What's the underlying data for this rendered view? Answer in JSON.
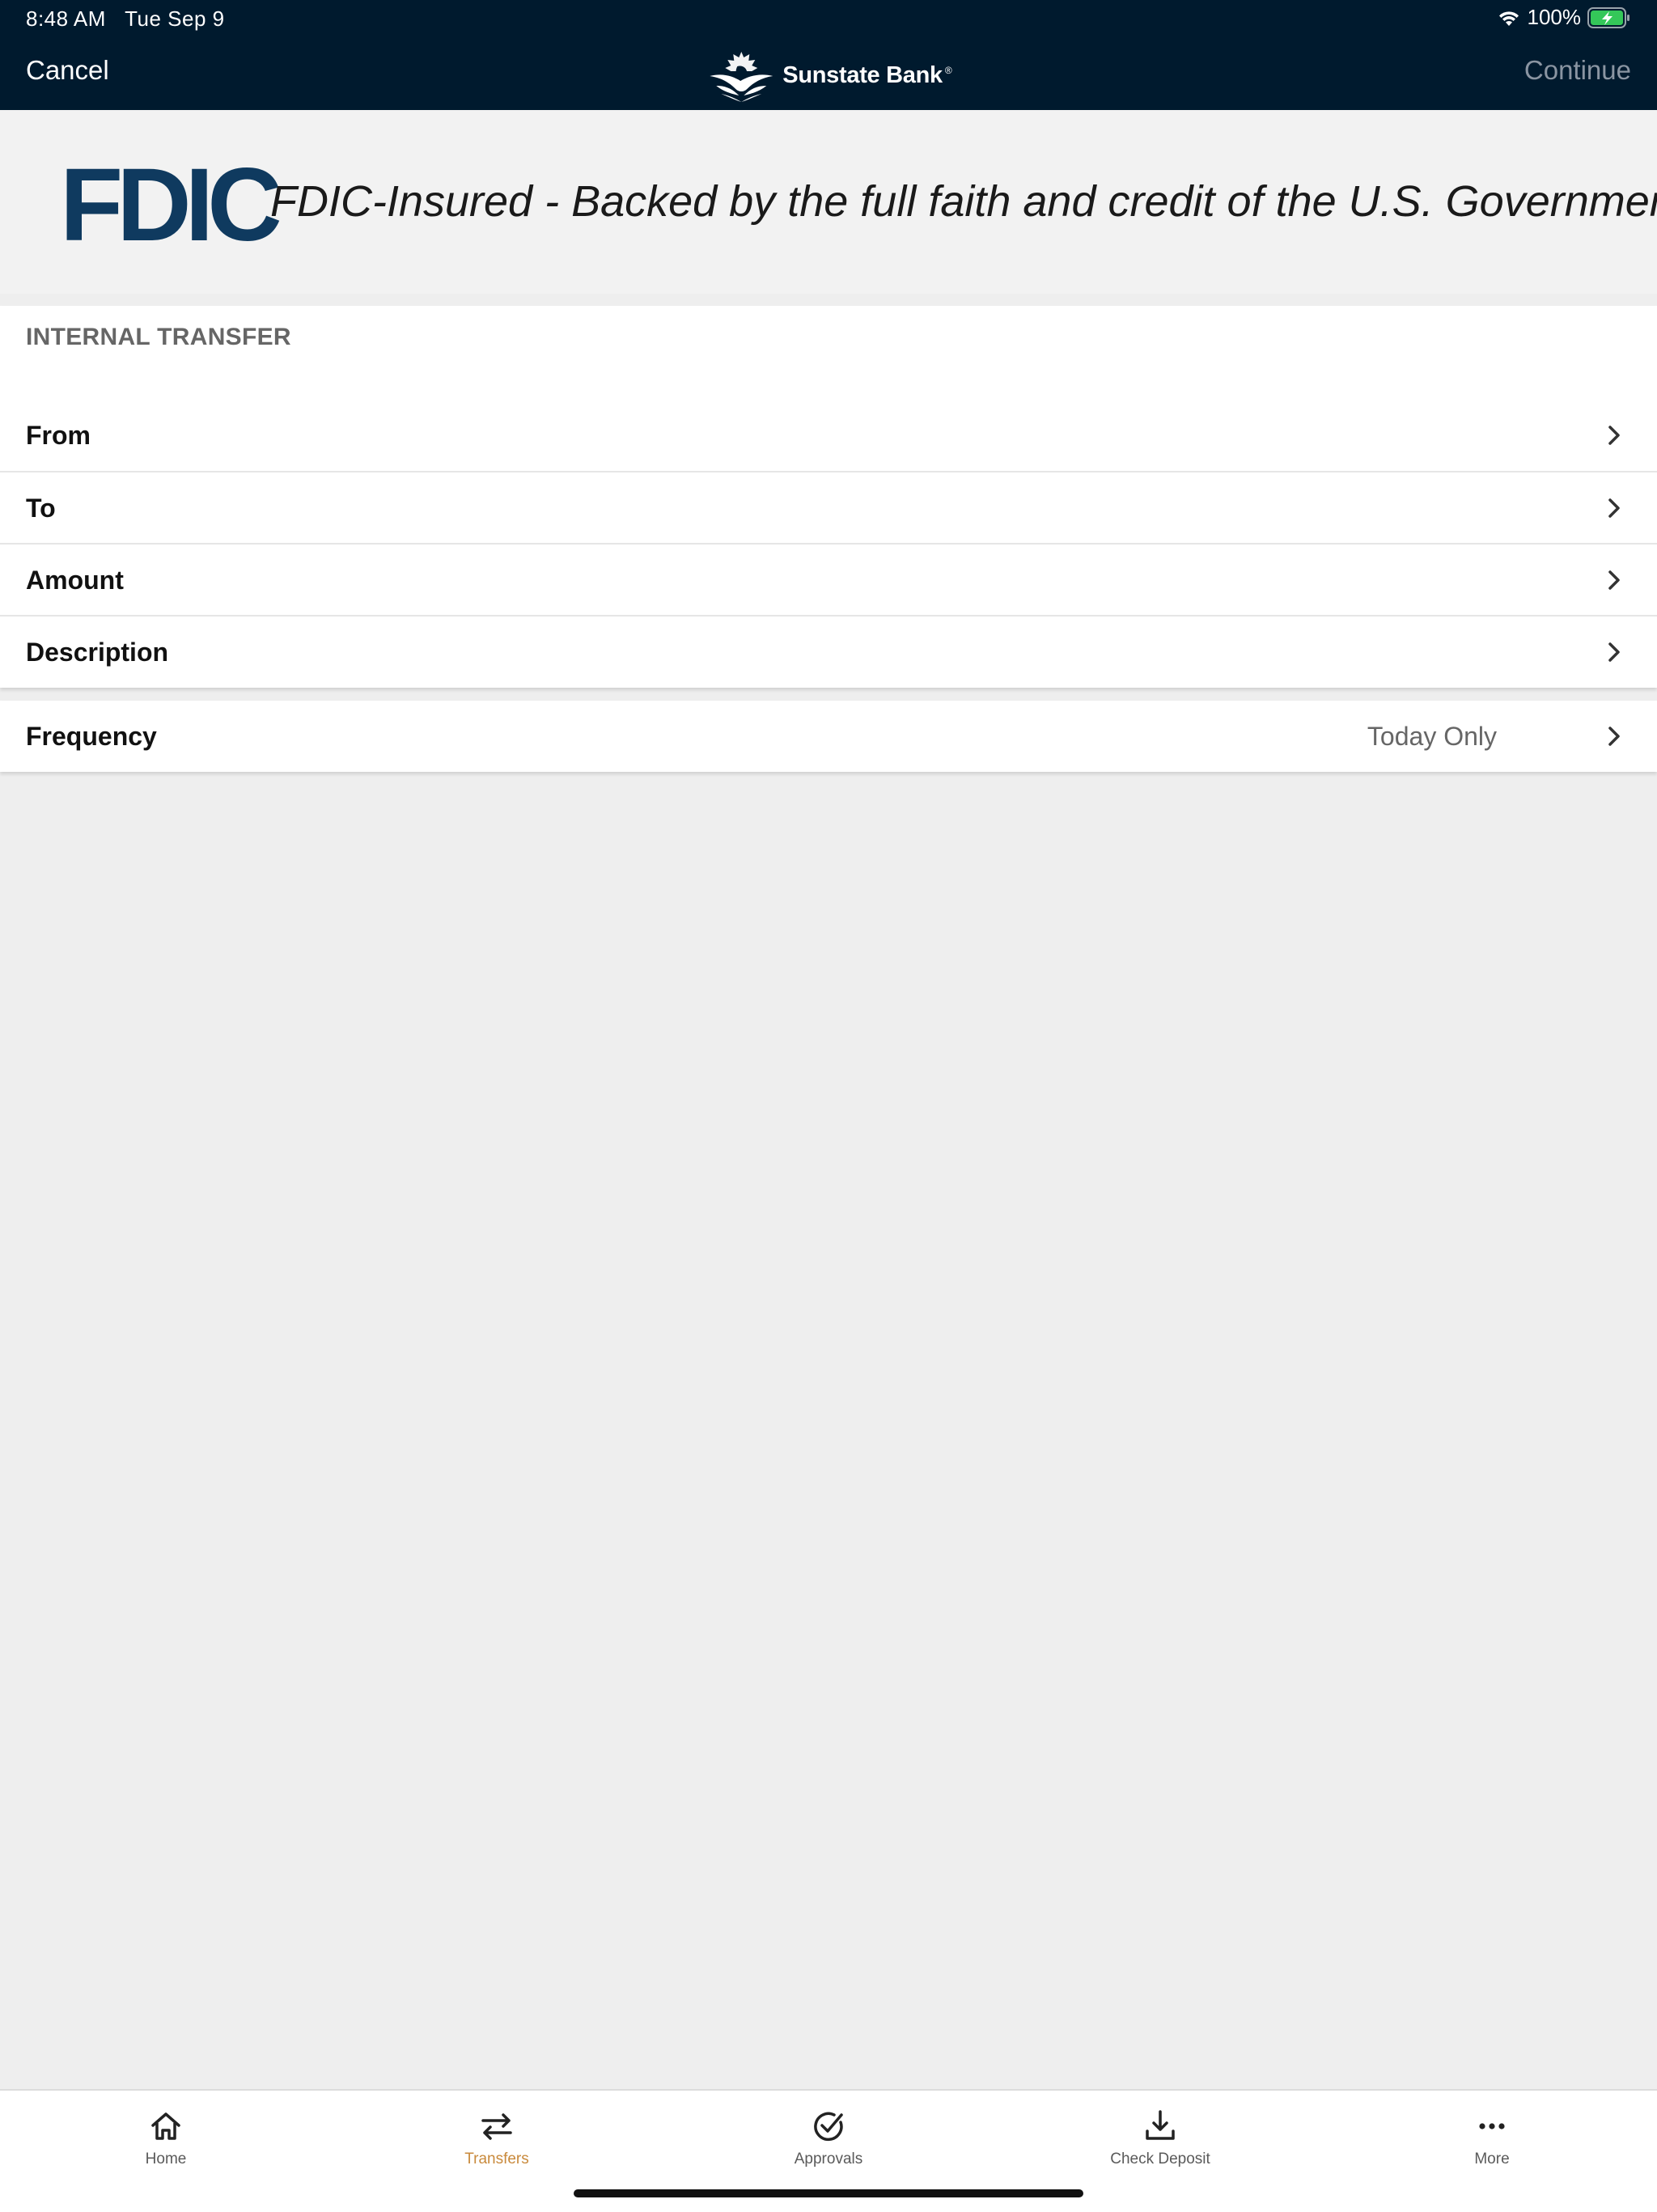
{
  "status_bar": {
    "time": "8:48 AM",
    "date": "Tue Sep 9",
    "battery": "100%"
  },
  "nav": {
    "cancel_label": "Cancel",
    "continue_label": "Continue",
    "brand_name": "Sunstate Bank",
    "brand_mark": "®"
  },
  "fdic": {
    "logo_text": "FDIC",
    "tagline": "FDIC-Insured - Backed by the full faith and credit of the U.S. Government"
  },
  "form": {
    "section_title": "INTERNAL TRANSFER",
    "rows": [
      {
        "label": "From",
        "value": ""
      },
      {
        "label": "To",
        "value": ""
      },
      {
        "label": "Amount",
        "value": ""
      },
      {
        "label": "Description",
        "value": ""
      }
    ],
    "frequency": {
      "label": "Frequency",
      "value": "Today Only"
    }
  },
  "tabs": [
    {
      "label": "Home",
      "icon": "home-icon",
      "active": false
    },
    {
      "label": "Transfers",
      "icon": "transfer-icon",
      "active": true
    },
    {
      "label": "Approvals",
      "icon": "approval-check-icon",
      "active": false
    },
    {
      "label": "Check Deposit",
      "icon": "download-tray-icon",
      "active": false
    },
    {
      "label": "More",
      "icon": "ellipsis-icon",
      "active": false
    }
  ],
  "colors": {
    "header_bg": "#001a2e",
    "fdic_blue": "#0f3a5f",
    "active_tab": "#c98a3c",
    "battery_green": "#34c759"
  }
}
